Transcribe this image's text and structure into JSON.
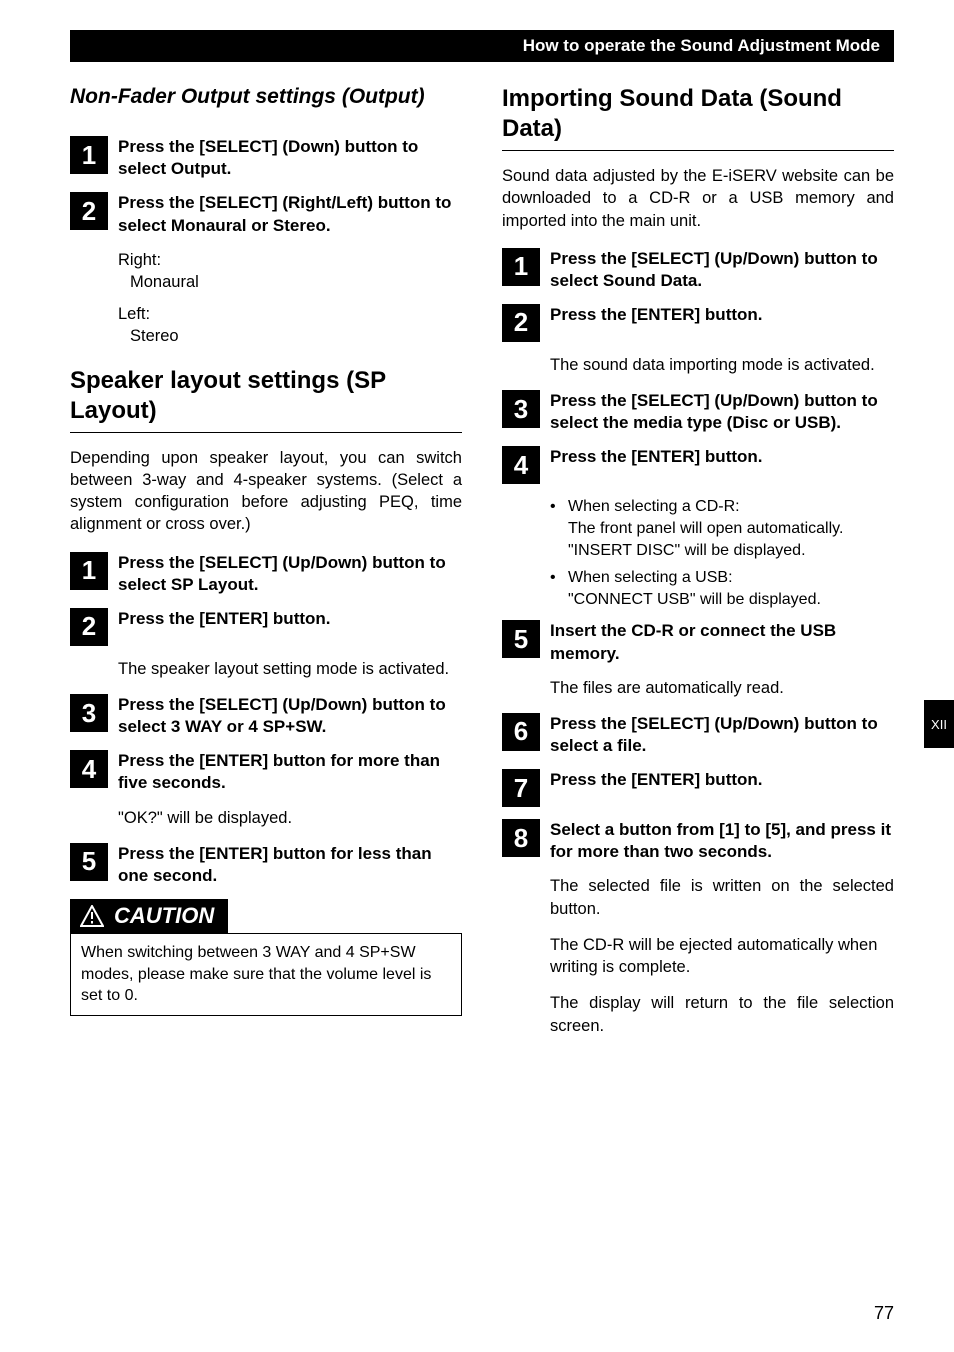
{
  "header": {
    "title": "How to operate the Sound Adjustment Mode"
  },
  "sideTab": "XII",
  "pageNumber": "77",
  "left": {
    "sectionA": {
      "title": "Non-Fader Output settings (Output)",
      "steps": [
        {
          "num": "1",
          "text": "Press the [SELECT] (Down) button to select Output."
        },
        {
          "num": "2",
          "text": "Press the [SELECT] (Right/Left) button to select Monaural or Stereo."
        }
      ],
      "rightLabel": "Right:",
      "rightValue": "Monaural",
      "leftLabel": "Left:",
      "leftValue": "Stereo"
    },
    "sectionB": {
      "title": "Speaker layout settings (SP Layout)",
      "intro": "Depending upon speaker layout, you can switch between 3-way and 4-speaker systems. (Select a system configuration before adjusting PEQ, time alignment or cross over.)",
      "steps": [
        {
          "num": "1",
          "text": "Press the [SELECT] (Up/Down) button to select SP Layout."
        },
        {
          "num": "2",
          "text": "Press the [ENTER] button.",
          "follow": "The speaker layout setting mode is activated."
        },
        {
          "num": "3",
          "text": "Press the [SELECT] (Up/Down) button to select 3 WAY or 4 SP+SW."
        },
        {
          "num": "4",
          "text": "Press the [ENTER] button for more than five seconds.",
          "follow": "\"OK?\" will be displayed."
        },
        {
          "num": "5",
          "text": "Press the [ENTER] button for less than one second."
        }
      ],
      "caution": {
        "label": "CAUTION",
        "body": "When switching between 3 WAY and 4 SP+SW modes, please make sure that the volume level is set to 0."
      }
    }
  },
  "right": {
    "sectionC": {
      "title": "Importing Sound Data (Sound Data)",
      "intro": "Sound data adjusted by the E-iSERV website can be downloaded to a CD-R or a USB memory and imported into the main unit.",
      "steps": [
        {
          "num": "1",
          "text": "Press the [SELECT] (Up/Down) button to select Sound Data."
        },
        {
          "num": "2",
          "text": "Press the [ENTER] button.",
          "follow": "The sound data importing mode is activated."
        },
        {
          "num": "3",
          "text": "Press the [SELECT] (Up/Down) button to select the media type (Disc or USB)."
        },
        {
          "num": "4",
          "text": "Press the [ENTER] button."
        },
        {
          "num": "5",
          "text": "Insert the CD-R or connect the USB memory.",
          "follow": "The files are automatically read."
        },
        {
          "num": "6",
          "text": "Press the [SELECT] (Up/Down) button to select a file."
        },
        {
          "num": "7",
          "text": "Press the [ENTER] button."
        },
        {
          "num": "8",
          "text": "Select a button from [1] to [5], and press it for more than two seconds.",
          "followList": [
            "The selected file is written on the selected button.",
            "The CD-R will be ejected automatically when writing is complete.",
            "The display will return to the file selection screen."
          ]
        }
      ],
      "bullets": [
        {
          "head": "When selecting a CD-R:",
          "lines": [
            "The front panel will open automatically.",
            "\"INSERT DISC\" will be displayed."
          ]
        },
        {
          "head": "When selecting a USB:",
          "lines": [
            "\"CONNECT USB\" will be displayed."
          ]
        }
      ]
    }
  }
}
